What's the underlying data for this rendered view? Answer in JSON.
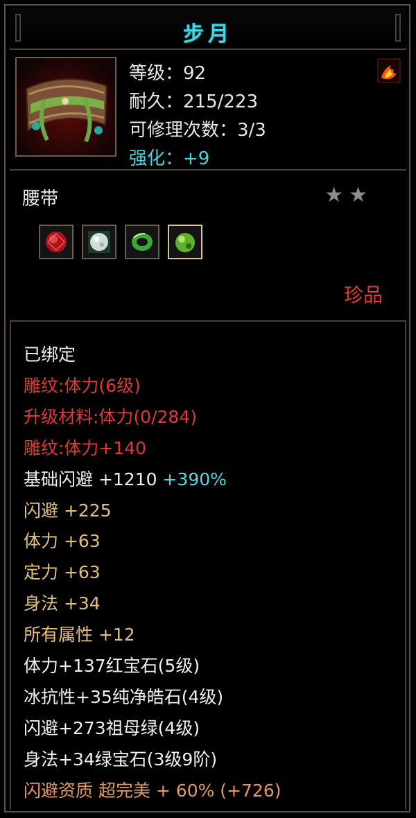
{
  "window": {
    "title": "步月"
  },
  "header": {
    "stats": [
      {
        "text": "等级：92",
        "color": "white"
      },
      {
        "text": "耐久：215/223",
        "color": "white"
      },
      {
        "text": "可修理次数：3/3",
        "color": "white"
      },
      {
        "text": "强化：+9",
        "color": "cyan"
      }
    ],
    "icons": {
      "item": "belt-icon",
      "badge": "flame-icon"
    }
  },
  "item": {
    "name": "腰带",
    "stars": "★★",
    "star_count": 2,
    "rarity": "珍品",
    "gems": [
      {
        "name": "red-gem-icon",
        "color": "#c8141e"
      },
      {
        "name": "white-gem-icon",
        "color": "#dfe8ea"
      },
      {
        "name": "green-ring-gem-icon",
        "color": "#3cae3c"
      },
      {
        "name": "green-gem-icon",
        "color": "#6ec832"
      }
    ]
  },
  "attributes": [
    {
      "text": "已绑定",
      "color": "white"
    },
    {
      "text": "雕纹:体力(6级)",
      "color": "red"
    },
    {
      "text": "升级材料:体力(0/284)",
      "color": "red"
    },
    {
      "text": "雕纹:体力+140",
      "color": "red"
    },
    {
      "text": "基础闪避 +1210",
      "extra": "+390%",
      "color": "white"
    },
    {
      "text": "闪避 +225",
      "color": "gold"
    },
    {
      "text": "体力 +63",
      "color": "gold"
    },
    {
      "text": "定力 +63",
      "color": "gold"
    },
    {
      "text": "身法 +34",
      "color": "gold"
    },
    {
      "text": "所有属性 +12",
      "color": "gold"
    },
    {
      "text": "体力+137红宝石(5级)",
      "color": "white"
    },
    {
      "text": "冰抗性+35纯净皓石(4级)",
      "color": "white"
    },
    {
      "text": "闪避+273祖母绿(4级)",
      "color": "white"
    },
    {
      "text": "身法+34绿宝石(3级9阶)",
      "color": "white"
    },
    {
      "text": "闪避资质 超完美 + 60% (+726)",
      "color": "orange"
    }
  ],
  "colors": {
    "title": "#3fd8e8",
    "cyan": "#4fd9e6",
    "red": "#e03a34",
    "gold": "#e3c07a",
    "orange": "#e39a60",
    "rarity": "#e23b2f",
    "border": "#4a4036"
  }
}
